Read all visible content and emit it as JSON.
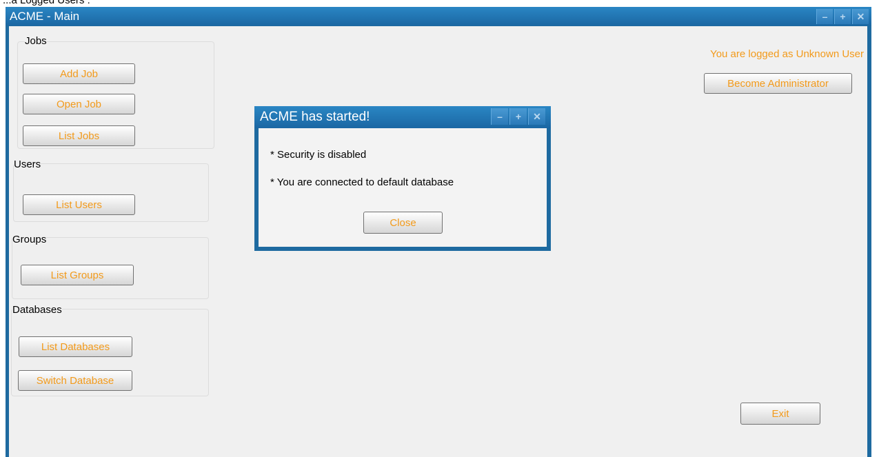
{
  "caption": "...a Logged Users :",
  "window": {
    "title": "ACME - Main",
    "controls": [
      "–",
      "+",
      "✕"
    ]
  },
  "sections": {
    "jobs": {
      "label": "Jobs",
      "buttons": [
        "Add Job",
        "Open Job",
        "List Jobs"
      ]
    },
    "users": {
      "label": "Users",
      "buttons": [
        "List Users"
      ]
    },
    "groups": {
      "label": "Groups",
      "buttons": [
        "List Groups"
      ]
    },
    "databases": {
      "label": "Databases",
      "buttons": [
        "List Databases",
        "Switch Database"
      ]
    }
  },
  "status": {
    "logged_text": "You are logged as Unknown User",
    "become_admin_label": "Become Administrator"
  },
  "exit_label": "Exit",
  "dialog": {
    "title": "ACME has started!",
    "lines": [
      "* Security is disabled",
      "* You are connected to default database"
    ],
    "close_label": "Close",
    "controls": [
      "–",
      "+",
      "✕"
    ]
  },
  "colors": {
    "accent_text": "#f29a1b",
    "titlebar": "#1e6aa0"
  },
  "icons": [
    "minimize-icon",
    "maximize-icon",
    "close-icon"
  ]
}
